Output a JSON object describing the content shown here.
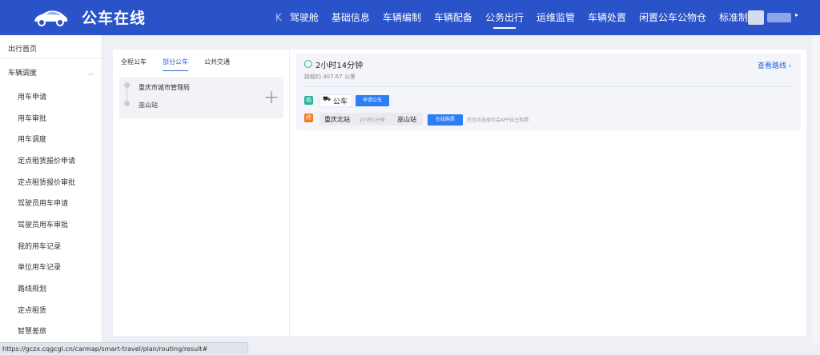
{
  "app": {
    "title": "公车在线"
  },
  "nav": {
    "collapse_icon": "collapse-icon",
    "items": [
      "驾驶舱",
      "基础信息",
      "车辆编制",
      "车辆配备",
      "公务出行",
      "运维监管",
      "车辆处置",
      "闲置公车公物仓",
      "标准制度"
    ],
    "active": "公务出行"
  },
  "sidebar": {
    "top": "出行首页",
    "group": "车辆调度",
    "items": [
      "用车申请",
      "用车审批",
      "用车调度",
      "定点租赁报价申请",
      "定点租赁报价审批",
      "驾驶员用车申请",
      "驾驶员用车审批",
      "我的用车记录",
      "单位用车记录",
      "路线规划",
      "定点租赁",
      "智慧差旅"
    ]
  },
  "tabs": {
    "items": [
      "全程公车",
      "部分公车",
      "公共交通"
    ],
    "active": "部分公车"
  },
  "route": {
    "from": "重庆市城市管理局",
    "to": "巫山站"
  },
  "result": {
    "duration": "2小时14分钟",
    "distance": "路程约 407.67 公里",
    "view_route": "查看路线 ›",
    "start_badge": "始",
    "end_badge": "终",
    "car_label": "公车",
    "apply_button": "申请公车",
    "train_from": "重庆北站",
    "train_duration": "2小时1分钟",
    "train_to": "巫山站",
    "buy_button": "在线购票",
    "note": "您也可选择社会APP自主购票"
  },
  "status": {
    "url": "https://gczx.cqgcgl.cn/carmap/smart-travel/plan/routing/result#"
  },
  "colors": {
    "header": "#2a52c9",
    "accent": "#2a66d8",
    "button": "#2e7cf6",
    "start": "#25b59a",
    "end": "#ef7c1c"
  }
}
